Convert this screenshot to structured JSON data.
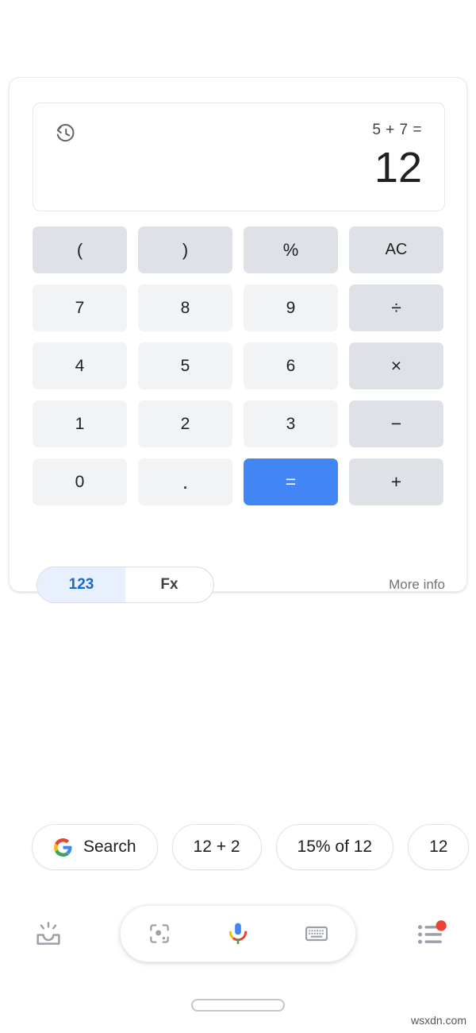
{
  "calculator": {
    "display": {
      "history_icon": "history-icon",
      "expression": "5 + 7 =",
      "result": "12"
    },
    "keys": [
      {
        "label": "(",
        "type": "fn",
        "name": "key-open-paren"
      },
      {
        "label": ")",
        "type": "fn",
        "name": "key-close-paren"
      },
      {
        "label": "%",
        "type": "fn",
        "name": "key-percent"
      },
      {
        "label": "AC",
        "type": "fn",
        "name": "key-all-clear"
      },
      {
        "label": "7",
        "type": "num",
        "name": "key-7"
      },
      {
        "label": "8",
        "type": "num",
        "name": "key-8"
      },
      {
        "label": "9",
        "type": "num",
        "name": "key-9"
      },
      {
        "label": "÷",
        "type": "op",
        "name": "key-divide"
      },
      {
        "label": "4",
        "type": "num",
        "name": "key-4"
      },
      {
        "label": "5",
        "type": "num",
        "name": "key-5"
      },
      {
        "label": "6",
        "type": "num",
        "name": "key-6"
      },
      {
        "label": "×",
        "type": "op",
        "name": "key-multiply"
      },
      {
        "label": "1",
        "type": "num",
        "name": "key-1"
      },
      {
        "label": "2",
        "type": "num",
        "name": "key-2"
      },
      {
        "label": "3",
        "type": "num",
        "name": "key-3"
      },
      {
        "label": "−",
        "type": "op",
        "name": "key-subtract"
      },
      {
        "label": "0",
        "type": "num",
        "name": "key-0"
      },
      {
        "label": ".",
        "type": "dot",
        "name": "key-decimal"
      },
      {
        "label": "=",
        "type": "eq",
        "name": "key-equals"
      },
      {
        "label": "+",
        "type": "op",
        "name": "key-add"
      }
    ],
    "mode_toggle": {
      "numeric_label": "123",
      "function_label": "Fx",
      "selected": "123"
    },
    "more_info_label": "More info"
  },
  "chips": [
    {
      "label": "Search",
      "icon": "google-g-icon",
      "name": "chip-search"
    },
    {
      "label": "12 + 2",
      "icon": "",
      "name": "chip-12-plus-2"
    },
    {
      "label": "15% of 12",
      "icon": "",
      "name": "chip-15-percent-of-12"
    },
    {
      "label": "12",
      "icon": "",
      "name": "chip-12-truncated"
    }
  ],
  "bottom_bar": {
    "discover_icon": "discover-tray-icon",
    "lens_icon": "google-lens-icon",
    "mic_icon": "google-mic-icon",
    "keyboard_icon": "keyboard-icon",
    "updates_icon": "updates-list-icon",
    "updates_badge": true
  },
  "colors": {
    "accent_blue": "#4285f4",
    "toggle_active_bg": "#e8f0fe",
    "toggle_active_text": "#1967d2",
    "key_bg": "#f1f3f4",
    "key_fn_bg": "#dee1e6",
    "badge_red": "#ea4335"
  },
  "watermark": "wsxdn.com"
}
